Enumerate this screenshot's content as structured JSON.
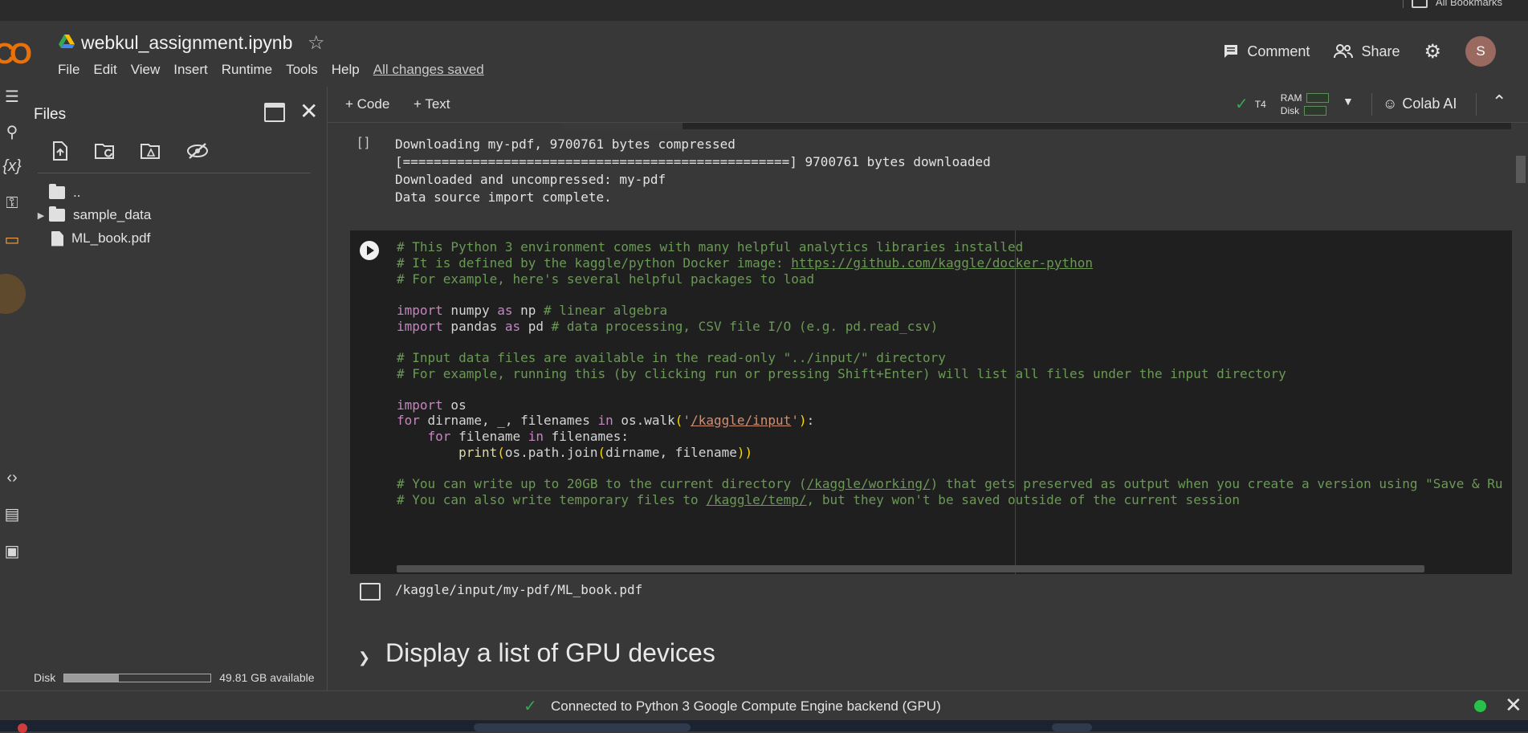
{
  "browser": {
    "bookmarks_label": "All Bookmarks"
  },
  "header": {
    "notebook_title": "webkul_assignment.ipynb",
    "logo_text": "CO",
    "menu": [
      "File",
      "Edit",
      "View",
      "Insert",
      "Runtime",
      "Tools",
      "Help"
    ],
    "save_status": "All changes saved",
    "comment_label": "Comment",
    "share_label": "Share",
    "avatar_letter": "S"
  },
  "rail": {
    "icons": [
      "table-of-contents-icon",
      "search-icon",
      "variables-icon",
      "secrets-key-icon",
      "files-folder-icon",
      "code-snippets-icon",
      "command-palette-icon",
      "terminal-icon"
    ]
  },
  "files_panel": {
    "title": "Files",
    "toolbar_icons": [
      "upload-icon",
      "refresh-icon",
      "mount-drive-icon",
      "hide-files-icon"
    ],
    "tree": [
      {
        "label": "..",
        "type": "parent"
      },
      {
        "label": "sample_data",
        "type": "folder"
      },
      {
        "label": "ML_book.pdf",
        "type": "file"
      }
    ],
    "disk_label": "Disk",
    "disk_available": "49.81 GB available",
    "disk_used_fraction": 0.37
  },
  "toolbar": {
    "add_code": "+ Code",
    "add_text": "+ Text",
    "gpu_label": "T4",
    "ram_label": "RAM",
    "disk_label": "Disk",
    "colab_ai": "Colab AI"
  },
  "cells": {
    "output_top": {
      "run_marker": "[ ]",
      "lines": [
        "Downloading my-pdf, 9700761 bytes compressed",
        "[==================================================] 9700761 bytes downloaded",
        "Downloaded and uncompressed: my-pdf",
        "Data source import complete."
      ]
    },
    "code_output": "/kaggle/input/my-pdf/ML_book.pdf",
    "section_heading": "Display a list of GPU devices"
  },
  "status": {
    "text": "Connected to Python 3 Google Compute Engine backend (GPU)"
  },
  "colors": {
    "accent_green": "#34a853",
    "logo_orange": "#f9ab00",
    "code_bg": "#1f1f1f",
    "comment": "#6a9955"
  }
}
